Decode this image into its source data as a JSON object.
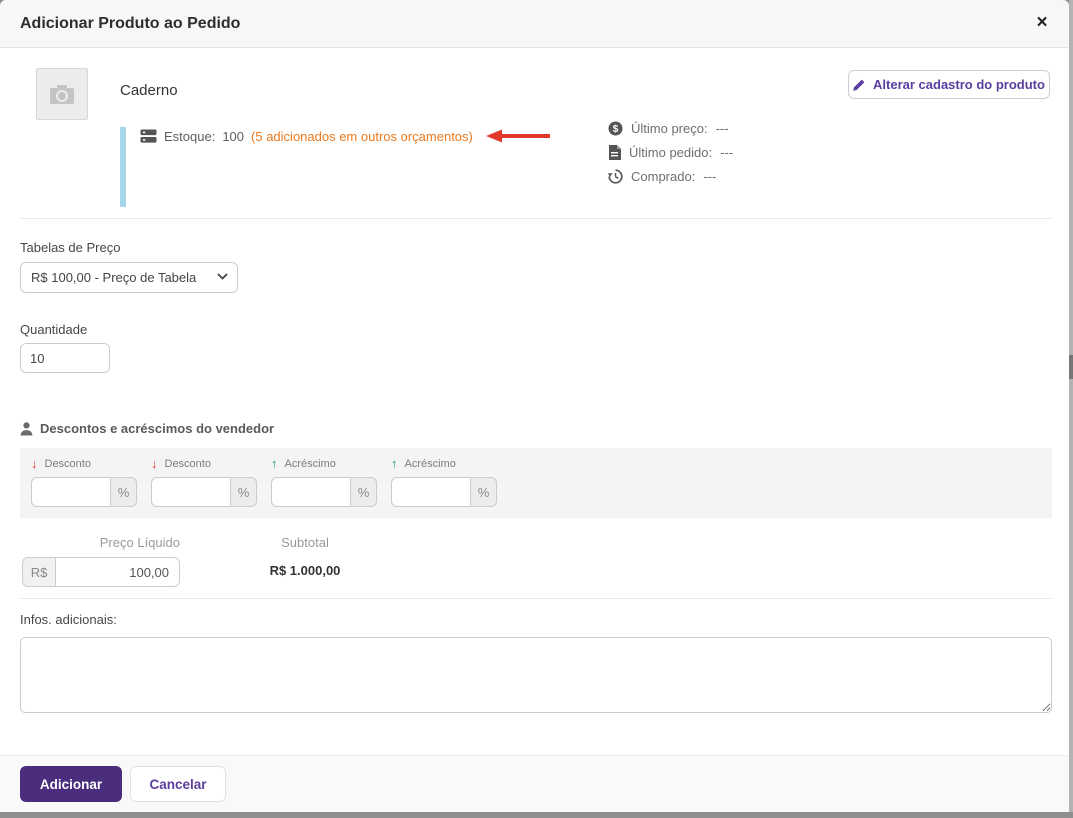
{
  "modal": {
    "title": "Adicionar Produto ao Pedido",
    "close_label": "×"
  },
  "product": {
    "name": "Caderno",
    "edit_button_label": "Alterar cadastro do produto",
    "stock": {
      "label": "Estoque:",
      "value": "100",
      "note": "(5 adicionados em outros orçamentos)"
    },
    "history": [
      {
        "icon": "dollar-circle-icon",
        "label": "Último preço:",
        "value": "---"
      },
      {
        "icon": "document-icon",
        "label": "Último pedido:",
        "value": "---"
      },
      {
        "icon": "history-clock-icon",
        "label": "Comprado:",
        "value": "---"
      }
    ]
  },
  "price_table": {
    "label": "Tabelas de Preço",
    "selected_option": "R$ 100,00 - Preço de Tabela"
  },
  "quantity": {
    "label": "Quantidade",
    "value": "10"
  },
  "adjustments": {
    "heading": "Descontos e acréscimos do vendedor",
    "fields": [
      {
        "label": "Desconto",
        "direction": "down",
        "arrow": "↓",
        "suffix": "%",
        "value": ""
      },
      {
        "label": "Desconto",
        "direction": "down",
        "arrow": "↓",
        "suffix": "%",
        "value": ""
      },
      {
        "label": "Acréscimo",
        "direction": "up",
        "arrow": "↑",
        "suffix": "%",
        "value": ""
      },
      {
        "label": "Acréscimo",
        "direction": "up",
        "arrow": "↑",
        "suffix": "%",
        "value": ""
      }
    ]
  },
  "pricing": {
    "net_price_label": "Preço Líquido",
    "currency_prefix": "R$",
    "net_price_value": "100,00",
    "subtotal_label": "Subtotal",
    "subtotal_value": "R$ 1.000,00"
  },
  "notes": {
    "label": "Infos. adicionais:",
    "value": ""
  },
  "footer": {
    "add_label": "Adicionar",
    "cancel_label": "Cancelar"
  },
  "colors": {
    "accent_purple": "#4b2d7e",
    "link_purple": "#5b3e9d",
    "orange_note": "#ed7a1f",
    "arrow_red": "#e0392a",
    "arrow_green": "#1faa5a",
    "stock_bar_blue": "#a5d6e9"
  }
}
